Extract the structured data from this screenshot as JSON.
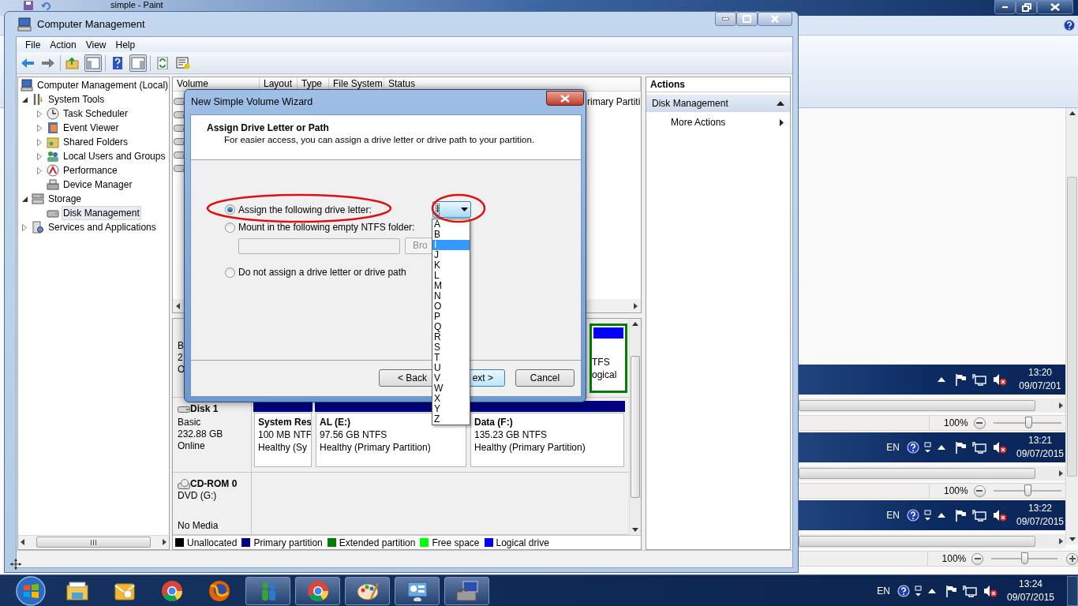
{
  "paint_window": {
    "title": "simple - Paint"
  },
  "computer_management": {
    "title": "Computer Management",
    "menu": [
      "File",
      "Action",
      "View",
      "Help"
    ],
    "tree": [
      {
        "label": "Computer Management (Local)",
        "selected": false,
        "children": [
          {
            "label": "System Tools",
            "expanded": true,
            "selected": false,
            "children": [
              {
                "label": "Task Scheduler",
                "expanded": false,
                "selected": false
              },
              {
                "label": "Event Viewer",
                "expanded": false,
                "selected": false
              },
              {
                "label": "Shared Folders",
                "expanded": false,
                "selected": false
              },
              {
                "label": "Local Users and Groups",
                "expanded": false,
                "selected": false
              },
              {
                "label": "Performance",
                "expanded": false,
                "selected": false
              },
              {
                "label": "Device Manager",
                "selected": false
              }
            ]
          },
          {
            "label": "Storage",
            "expanded": true,
            "selected": false,
            "children": [
              {
                "label": "Disk Management",
                "selected": true
              }
            ]
          },
          {
            "label": "Services and Applications",
            "expanded": false,
            "selected": false
          }
        ]
      }
    ],
    "volume_columns": [
      "Volume",
      "Layout",
      "Type",
      "File System",
      "Status"
    ],
    "volume_row_fragments": [
      "rimary Partiti"
    ],
    "disk_0_fragments": {
      "label_lines": [
        "B",
        "2",
        "O"
      ],
      "partition_lines": [
        "TFS",
        "ogical"
      ],
      "color": "#0000ff"
    },
    "disks": [
      {
        "name": "Disk 1",
        "lines": [
          "Basic",
          "232.88 GB",
          "Online"
        ],
        "partitions": [
          {
            "name": "System Res",
            "size": "100 MB NTF",
            "status": "Healthy (Sy",
            "color": "#000080"
          },
          {
            "name": "AL  (E:)",
            "size": "97.56 GB NTFS",
            "status": "Healthy (Primary Partition)",
            "color": "#000080"
          },
          {
            "name": "Data  (F:)",
            "size": "135.23 GB NTFS",
            "status": "Healthy (Primary Partition)",
            "color": "#000080"
          }
        ]
      },
      {
        "name": "CD-ROM 0",
        "lines": [
          "DVD (G:)",
          "No Media"
        ]
      }
    ],
    "legend": [
      {
        "label": "Unallocated",
        "color": "#000000"
      },
      {
        "label": "Primary partition",
        "color": "#000080"
      },
      {
        "label": "Extended partition",
        "color": "#008000"
      },
      {
        "label": "Free space",
        "color": "#00ff00"
      },
      {
        "label": "Logical drive",
        "color": "#0000ff"
      }
    ],
    "actions": {
      "title": "Actions",
      "section": "Disk Management",
      "items": [
        "More Actions"
      ]
    }
  },
  "wizard": {
    "title": "New Simple Volume Wizard",
    "heading": "Assign Drive Letter or Path",
    "subheading": "For easier access, you can assign a drive letter or drive path to your partition.",
    "options": [
      {
        "label": "Assign the following drive letter:",
        "selected": true
      },
      {
        "label": "Mount in the following empty NTFS folder:",
        "selected": false
      },
      {
        "label": "Do not assign a drive letter or drive path",
        "selected": false
      }
    ],
    "folder_field": {
      "disabled": true
    },
    "browse_button": {
      "label": "Bro",
      "disabled": true
    },
    "drive_letter": {
      "value": "I",
      "open": true,
      "options": [
        {
          "label": "A",
          "selected": false
        },
        {
          "label": "B",
          "selected": false
        },
        {
          "label": "I",
          "selected": true
        },
        {
          "label": "J",
          "selected": false
        },
        {
          "label": "K",
          "selected": false
        },
        {
          "label": "L",
          "selected": false
        },
        {
          "label": "M",
          "selected": false
        },
        {
          "label": "N",
          "selected": false
        },
        {
          "label": "O",
          "selected": false
        },
        {
          "label": "P",
          "selected": false
        },
        {
          "label": "Q",
          "selected": false
        },
        {
          "label": "R",
          "selected": false
        },
        {
          "label": "S",
          "selected": false
        },
        {
          "label": "T",
          "selected": false
        },
        {
          "label": "U",
          "selected": false
        },
        {
          "label": "V",
          "selected": false
        },
        {
          "label": "W",
          "selected": false
        },
        {
          "label": "X",
          "selected": false
        },
        {
          "label": "Y",
          "selected": false
        },
        {
          "label": "Z",
          "selected": false
        }
      ]
    },
    "buttons": [
      {
        "label": "< Back",
        "default": false
      },
      {
        "label": "ext >",
        "default": true
      },
      {
        "label": "Cancel",
        "default": false
      }
    ]
  },
  "pasted_strips": [
    {
      "time": "13:20",
      "date": "09/07/201",
      "zoom": "100%",
      "level": 0.52,
      "plus": false
    },
    {
      "lang": "EN",
      "time": "13:21",
      "date": "09/07/2015",
      "zoom": "100%",
      "level": 0.5,
      "plus": false
    },
    {
      "lang": "EN",
      "time": "13:22",
      "date": "09/07/2015",
      "zoom": "100%",
      "level": 0.5,
      "plus": true
    }
  ],
  "taskbar": {
    "apps": [
      {
        "kind": "explorer",
        "running": false
      },
      {
        "kind": "mail",
        "running": false
      },
      {
        "kind": "chrome",
        "running": false
      },
      {
        "kind": "firefox",
        "running": false
      },
      {
        "kind": "people",
        "running": true
      },
      {
        "kind": "chrome",
        "running": true
      },
      {
        "kind": "paint",
        "running": true
      },
      {
        "kind": "panel",
        "running": true
      },
      {
        "kind": "toolbox",
        "running": true
      }
    ],
    "lang": "EN",
    "time": "13:24",
    "date": "09/07/2015"
  }
}
